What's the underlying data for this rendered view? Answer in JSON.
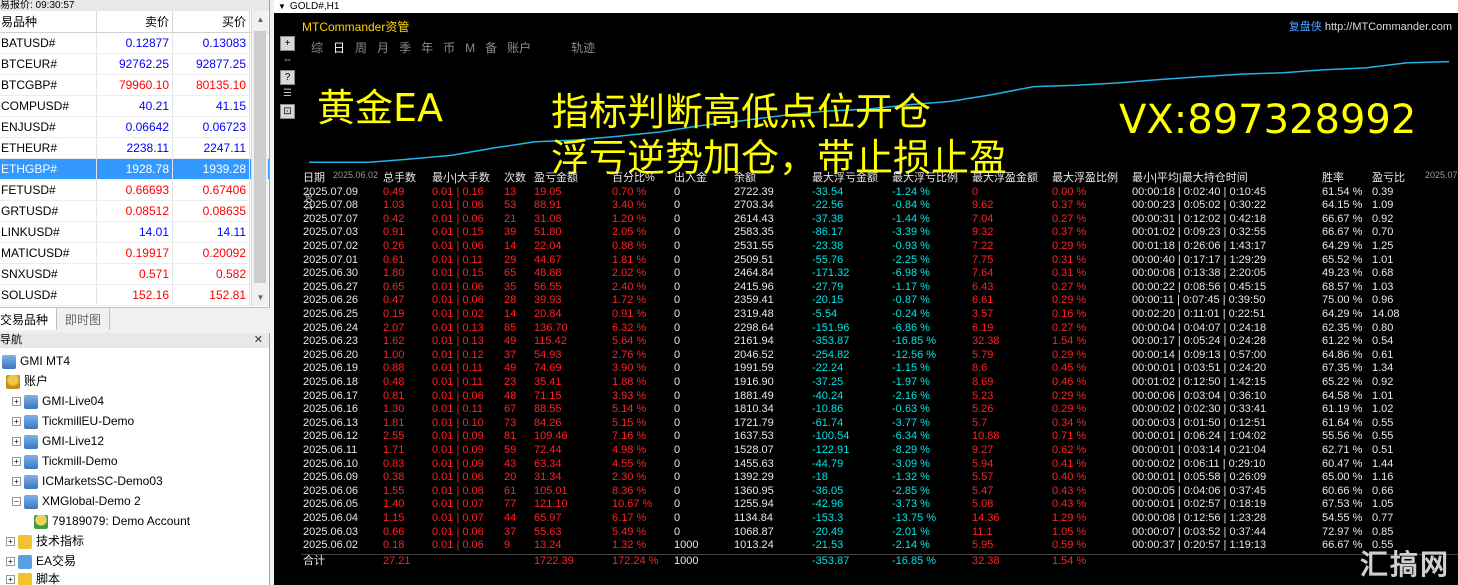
{
  "market_watch": {
    "title": "易报价: 09:30:57",
    "headers": [
      "易品种",
      "卖价",
      "买价"
    ],
    "rows": [
      {
        "symbol": "BATUSD#",
        "bid": "0.12877",
        "ask": "0.13083",
        "bid_dir": "up",
        "ask_dir": "up"
      },
      {
        "symbol": "BTCEUR#",
        "bid": "92762.25",
        "ask": "92877.25",
        "bid_dir": "up",
        "ask_dir": "up"
      },
      {
        "symbol": "BTCGBP#",
        "bid": "79960.10",
        "ask": "80135.10",
        "bid_dir": "dn",
        "ask_dir": "dn"
      },
      {
        "symbol": "COMPUSD#",
        "bid": "40.21",
        "ask": "41.15",
        "bid_dir": "up",
        "ask_dir": "up"
      },
      {
        "symbol": "ENJUSD#",
        "bid": "0.06642",
        "ask": "0.06723",
        "bid_dir": "up",
        "ask_dir": "up"
      },
      {
        "symbol": "ETHEUR#",
        "bid": "2238.11",
        "ask": "2247.11",
        "bid_dir": "up",
        "ask_dir": "up"
      },
      {
        "symbol": "ETHGBP#",
        "bid": "1928.78",
        "ask": "1939.28",
        "bid_dir": "up",
        "ask_dir": "up",
        "selected": true
      },
      {
        "symbol": "FETUSD#",
        "bid": "0.66693",
        "ask": "0.67406",
        "bid_dir": "dn",
        "ask_dir": "dn"
      },
      {
        "symbol": "GRTUSD#",
        "bid": "0.08512",
        "ask": "0.08635",
        "bid_dir": "dn",
        "ask_dir": "dn"
      },
      {
        "symbol": "LINKUSD#",
        "bid": "14.01",
        "ask": "14.11",
        "bid_dir": "up",
        "ask_dir": "up"
      },
      {
        "symbol": "MATICUSD#",
        "bid": "0.19917",
        "ask": "0.20092",
        "bid_dir": "dn",
        "ask_dir": "dn"
      },
      {
        "symbol": "SNXUSD#",
        "bid": "0.571",
        "ask": "0.582",
        "bid_dir": "dn",
        "ask_dir": "dn"
      },
      {
        "symbol": "SOLUSD#",
        "bid": "152.16",
        "ask": "152.81",
        "bid_dir": "dn",
        "ask_dir": "dn"
      }
    ],
    "tabs": [
      "交易品种",
      "即时图"
    ]
  },
  "navigator": {
    "title": "导航",
    "root": "GMI MT4",
    "accounts_label": "账户",
    "servers": [
      "GMI-Live04",
      "TickmillEU-Demo",
      "GMI-Live12",
      "Tickmill-Demo",
      "ICMarketsSC-Demo03",
      "XMGlobal-Demo 2"
    ],
    "account": "79189079: Demo Account",
    "indicators_label": "技术指标",
    "ea_label": "EA交易",
    "scripts_label": "脚本"
  },
  "chart": {
    "title": "GOLD#,H1",
    "tools": [
      "+",
      "⇔",
      "?",
      "☰",
      "⊡"
    ],
    "mtc_name": "MTCommander资管",
    "mtc_brand": "复盘侠",
    "mtc_site": "http://MTCommander.com",
    "tabs": [
      "综",
      "日",
      "周",
      "月",
      "季",
      "年",
      "币",
      "M",
      "备",
      "账户",
      "轨迹"
    ],
    "curve_start": "2025.06.02",
    "curve_end": "2025.07.09",
    "rotated_label": "↑ 1.08",
    "overlay": {
      "l1": "黄金EA",
      "l2": "指标判断高低点位开仓",
      "l3": "浮亏逆势加仓，带止损止盈",
      "l4": "VX:897328992"
    },
    "columns": [
      "日期",
      "总手数",
      "最小|大手数",
      "次数",
      "盈亏金额",
      "百分比%",
      "出入金",
      "余额",
      "最大浮亏金额",
      "最大浮亏比例",
      "最大浮盈金额",
      "最大浮盈比例",
      "最小|平均|最大持仓时间",
      "胜率",
      "盈亏比"
    ],
    "rows": [
      [
        "2025.07.09",
        "0.49",
        "0.01 | 0.16",
        "13",
        "19.05",
        "0.70 %",
        "0",
        "2722.39",
        "-33.54",
        "-1.24 %",
        "0",
        "0.00 %",
        "00:00:18 | 0:02:40 | 0:10:45",
        "61.54 %",
        "0.39"
      ],
      [
        "2025.07.08",
        "1.03",
        "0.01 | 0.06",
        "53",
        "88.91",
        "3.40 %",
        "0",
        "2703.34",
        "-22.56",
        "-0.84 %",
        "9.62",
        "0.37 %",
        "00:00:23 | 0:05:02 | 0:30:22",
        "64.15 %",
        "1.09"
      ],
      [
        "2025.07.07",
        "0.42",
        "0.01 | 0.06",
        "21",
        "31.08",
        "1.20 %",
        "0",
        "2614.43",
        "-37.38",
        "-1.44 %",
        "7.04",
        "0.27 %",
        "00:00:31 | 0:12:02 | 0:42:18",
        "66.67 %",
        "0.92"
      ],
      [
        "2025.07.03",
        "0.91",
        "0.01 | 0.15",
        "39",
        "51.80",
        "2.05 %",
        "0",
        "2583.35",
        "-86.17",
        "-3.39 %",
        "9.32",
        "0.37 %",
        "00:01:02 | 0:09:23 | 0:32:55",
        "66.67 %",
        "0.70"
      ],
      [
        "2025.07.02",
        "0.26",
        "0.01 | 0.06",
        "14",
        "22.04",
        "0.88 %",
        "0",
        "2531.55",
        "-23.38",
        "-0.93 %",
        "7.22",
        "0.29 %",
        "00:01:18 | 0:26:06 | 1:43:17",
        "64.29 %",
        "1.25"
      ],
      [
        "2025.07.01",
        "0.61",
        "0.01 | 0.11",
        "29",
        "44.67",
        "1.81 %",
        "0",
        "2509.51",
        "-55.76",
        "-2.25 %",
        "7.75",
        "0.31 %",
        "00:00:40 | 0:17:17 | 1:29:29",
        "65.52 %",
        "1.01"
      ],
      [
        "2025.06.30",
        "1.80",
        "0.01 | 0.15",
        "65",
        "48.88",
        "2.02 %",
        "0",
        "2464.84",
        "-171.32",
        "-6.98 %",
        "7.64",
        "0.31 %",
        "00:00:08 | 0:13:38 | 2:20:05",
        "49.23 %",
        "0.68"
      ],
      [
        "2025.06.27",
        "0.65",
        "0.01 | 0.06",
        "35",
        "56.55",
        "2.40 %",
        "0",
        "2415.96",
        "-27.79",
        "-1.17 %",
        "6.43",
        "0.27 %",
        "00:00:22 | 0:08:56 | 0:45:15",
        "68.57 %",
        "1.03"
      ],
      [
        "2025.06.26",
        "0.47",
        "0.01 | 0.06",
        "28",
        "39.93",
        "1.72 %",
        "0",
        "2359.41",
        "-20.15",
        "-0.87 %",
        "6.61",
        "0.29 %",
        "00:00:11 | 0:07:45 | 0:39:50",
        "75.00 %",
        "0.96"
      ],
      [
        "2025.06.25",
        "0.19",
        "0.01 | 0.02",
        "14",
        "20.84",
        "0.91 %",
        "0",
        "2319.48",
        "-5.54",
        "-0.24 %",
        "3.57",
        "0.16 %",
        "00:02:20 | 0:11:01 | 0:22:51",
        "64.29 %",
        "14.08"
      ],
      [
        "2025.06.24",
        "2.07",
        "0.01 | 0.13",
        "85",
        "136.70",
        "6.32 %",
        "0",
        "2298.64",
        "-151.96",
        "-6.86 %",
        "6.19",
        "0.27 %",
        "00:00:04 | 0:04:07 | 0:24:18",
        "62.35 %",
        "0.80"
      ],
      [
        "2025.06.23",
        "1.62",
        "0.01 | 0.13",
        "49",
        "115.42",
        "5.64 %",
        "0",
        "2161.94",
        "-353.87",
        "-16.85 %",
        "32.38",
        "1.54 %",
        "00:00:17 | 0:05:24 | 0:24:28",
        "61.22 %",
        "0.54"
      ],
      [
        "2025.06.20",
        "1.00",
        "0.01 | 0.12",
        "37",
        "54.93",
        "2.76 %",
        "0",
        "2046.52",
        "-254.82",
        "-12.56 %",
        "5.79",
        "0.29 %",
        "00:00:14 | 0:09:13 | 0:57:00",
        "64.86 %",
        "0.61"
      ],
      [
        "2025.06.19",
        "0.88",
        "0.01 | 0.11",
        "49",
        "74.69",
        "3.90 %",
        "0",
        "1991.59",
        "-22.24",
        "-1.15 %",
        "8.6",
        "0.45 %",
        "00:00:01 | 0:03:51 | 0:24:20",
        "67.35 %",
        "1.34"
      ],
      [
        "2025.06.18",
        "0.48",
        "0.01 | 0.11",
        "23",
        "35.41",
        "1.88 %",
        "0",
        "1916.90",
        "-37.25",
        "-1.97 %",
        "8.69",
        "0.46 %",
        "00:01:02 | 0:12:50 | 1:42:15",
        "65.22 %",
        "0.92"
      ],
      [
        "2025.06.17",
        "0.81",
        "0.01 | 0.06",
        "48",
        "71.15",
        "3.93 %",
        "0",
        "1881.49",
        "-40.24",
        "-2.16 %",
        "5.23",
        "0.29 %",
        "00:00:06 | 0:03:04 | 0:36:10",
        "64.58 %",
        "1.01"
      ],
      [
        "2025.06.16",
        "1.30",
        "0.01 | 0.11",
        "67",
        "88.55",
        "5.14 %",
        "0",
        "1810.34",
        "-10.86",
        "-0.63 %",
        "5.26",
        "0.29 %",
        "00:00:02 | 0:02:30 | 0:33:41",
        "61.19 %",
        "1.02"
      ],
      [
        "2025.06.13",
        "1.81",
        "0.01 | 0.10",
        "73",
        "84.26",
        "5.15 %",
        "0",
        "1721.79",
        "-61.74",
        "-3.77 %",
        "5.7",
        "0.34 %",
        "00:00:03 | 0:01:50 | 0:12:51",
        "61.64 %",
        "0.55"
      ],
      [
        "2025.06.12",
        "2.55",
        "0.01 | 0.09",
        "81",
        "109.46",
        "7.16 %",
        "0",
        "1637.53",
        "-100.54",
        "-6.34 %",
        "10.88",
        "0.71 %",
        "00:00:01 | 0:06:24 | 1:04:02",
        "55.56 %",
        "0.55"
      ],
      [
        "2025.06.11",
        "1.71",
        "0.01 | 0.09",
        "59",
        "72.44",
        "4.98 %",
        "0",
        "1528.07",
        "-122.91",
        "-8.29 %",
        "9.27",
        "0.62 %",
        "00:00:01 | 0:03:14 | 0:21:04",
        "62.71 %",
        "0.51"
      ],
      [
        "2025.06.10",
        "0.83",
        "0.01 | 0.09",
        "43",
        "63.34",
        "4.55 %",
        "0",
        "1455.63",
        "-44.79",
        "-3.09 %",
        "5.94",
        "0.41 %",
        "00:00:02 | 0:06:11 | 0:29:10",
        "60.47 %",
        "1.44"
      ],
      [
        "2025.06.09",
        "0.38",
        "0.01 | 0.06",
        "20",
        "31.34",
        "2.30 %",
        "0",
        "1392.29",
        "-18",
        "-1.32 %",
        "5.57",
        "0.40 %",
        "00:00:01 | 0:05:58 | 0:26:09",
        "65.00 %",
        "1.16"
      ],
      [
        "2025.06.06",
        "1.55",
        "0.01 | 0.08",
        "61",
        "105.01",
        "8.36 %",
        "0",
        "1360.95",
        "-36.05",
        "-2.85 %",
        "5.47",
        "0.43 %",
        "00:00:05 | 0:04:06 | 0:37:45",
        "60.66 %",
        "0.66"
      ],
      [
        "2025.06.05",
        "1.40",
        "0.01 | 0.07",
        "77",
        "121.10",
        "10.67 %",
        "0",
        "1255.94",
        "-42.96",
        "-3.73 %",
        "5.08",
        "0.43 %",
        "00:00:01 | 0:02:57 | 0:18:19",
        "67.53 %",
        "1.05"
      ],
      [
        "2025.06.04",
        "1.15",
        "0.01 | 0.07",
        "44",
        "65.97",
        "6.17 %",
        "0",
        "1134.84",
        "-153.3",
        "-13.75 %",
        "14.36",
        "1.29 %",
        "00:00:08 | 0:12:56 | 1:23:28",
        "54.55 %",
        "0.77"
      ],
      [
        "2025.06.03",
        "0.66",
        "0.01 | 0.06",
        "37",
        "55.63",
        "5.49 %",
        "0",
        "1068.87",
        "-20.49",
        "-2.01 %",
        "11.1",
        "1.05 %",
        "00:00:07 | 0:03:52 | 0:37:44",
        "72.97 %",
        "0.85"
      ],
      [
        "2025.06.02",
        "0.18",
        "0.01 | 0.06",
        "9",
        "13.24",
        "1.32 %",
        "1000",
        "1013.24",
        "-21.53",
        "-2.14 %",
        "5.95",
        "0.59 %",
        "00:00:37 | 0:20:57 | 1:19:13",
        "66.67 %",
        "0.55"
      ]
    ],
    "total": [
      "合计",
      "27.21",
      "",
      "",
      "1722.39",
      "172.24 %",
      "1000",
      "",
      "-353.87",
      "-16.85 %",
      "32.38",
      "1.54 %",
      "",
      "",
      ""
    ],
    "balance_curve": [
      1013.24,
      1068.87,
      1134.84,
      1255.94,
      1360.95,
      1392.29,
      1455.63,
      1528.07,
      1637.53,
      1721.79,
      1810.34,
      1881.49,
      1916.9,
      1991.59,
      2046.52,
      2161.94,
      2298.64,
      2319.48,
      2359.41,
      2415.96,
      2464.84,
      2509.51,
      2531.55,
      2583.35,
      2614.43,
      2703.34,
      2722.39
    ],
    "colors": {
      "line": "#1fb5e8",
      "positive": "#ff2222",
      "negative": "#00e5e5",
      "overlay": "#ffff00"
    },
    "watermark": "汇搞网"
  }
}
